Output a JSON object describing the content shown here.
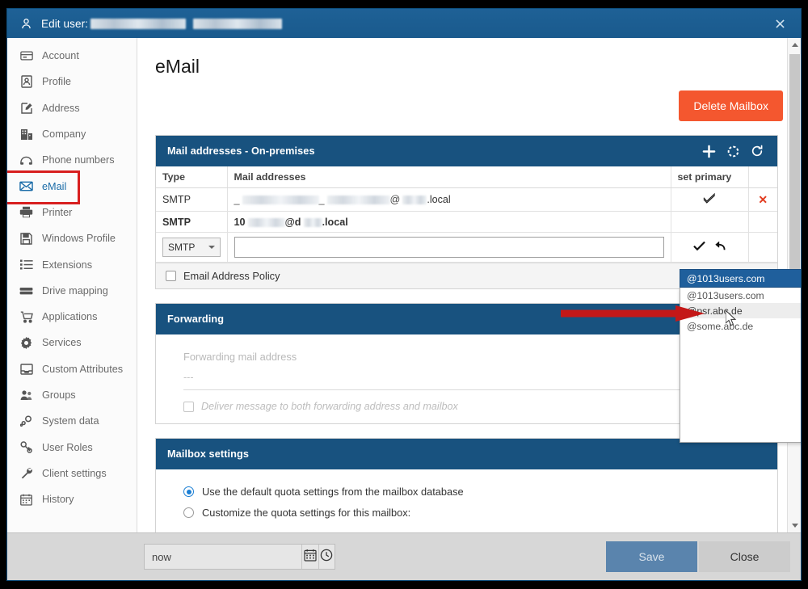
{
  "window": {
    "title_prefix": "Edit user:",
    "user_icon": "user-icon",
    "close_icon": "×"
  },
  "sidebar": {
    "items": [
      {
        "label": "Account",
        "icon": "account-card-icon",
        "active": false
      },
      {
        "label": "Profile",
        "icon": "profile-id-icon",
        "active": false
      },
      {
        "label": "Address",
        "icon": "address-edit-icon",
        "active": false
      },
      {
        "label": "Company",
        "icon": "company-building-icon",
        "active": false
      },
      {
        "label": "Phone numbers",
        "icon": "phone-icon",
        "active": false
      },
      {
        "label": "eMail",
        "icon": "envelope-icon",
        "active": true
      },
      {
        "label": "Printer",
        "icon": "printer-icon",
        "active": false
      },
      {
        "label": "Windows Profile",
        "icon": "floppy-disk-icon",
        "active": false
      },
      {
        "label": "Extensions",
        "icon": "list-icon",
        "active": false
      },
      {
        "label": "Drive mapping",
        "icon": "drive-icon",
        "active": false
      },
      {
        "label": "Applications",
        "icon": "cart-icon",
        "active": false
      },
      {
        "label": "Services",
        "icon": "gear-icon",
        "active": false
      },
      {
        "label": "Custom Attributes",
        "icon": "inbox-tray-icon",
        "active": false
      },
      {
        "label": "Groups",
        "icon": "groups-icon",
        "active": false
      },
      {
        "label": "System data",
        "icon": "system-data-icon",
        "active": false
      },
      {
        "label": "User Roles",
        "icon": "user-roles-key-icon",
        "active": false
      },
      {
        "label": "Client settings",
        "icon": "wrench-icon",
        "active": false
      },
      {
        "label": "History",
        "icon": "calendar-icon",
        "active": false
      }
    ]
  },
  "main": {
    "page_title": "eMail",
    "delete_mailbox_label": "Delete Mailbox",
    "delete_button_color": "#f4572f"
  },
  "mail_panel": {
    "header": "Mail addresses - On-premises",
    "header_color": "#18527f",
    "icons": [
      {
        "name": "add-icon",
        "glyph": "+"
      },
      {
        "name": "sync-icon",
        "glyph": "sync"
      },
      {
        "name": "refresh-icon",
        "glyph": "refresh"
      }
    ],
    "columns": [
      "Type",
      "Mail addresses",
      "set primary",
      ""
    ],
    "rows": [
      {
        "type": "SMTP",
        "address_suffix": ".local",
        "address_redacted": true,
        "bold": false,
        "set_primary_icon": "check-outline-icon",
        "delete_icon": "✕"
      },
      {
        "type": "SMTP",
        "address_prefix": "10",
        "address_middle": "@d",
        "address_suffix": ".local",
        "address_redacted": true,
        "bold": true,
        "set_primary_icon": "",
        "delete_icon": ""
      }
    ],
    "edit_row": {
      "type_value": "SMTP",
      "address_value": "",
      "address_placeholder": "",
      "domain_value": "@1013users.com",
      "confirm_icon": "check-solid-icon",
      "undo_icon": "undo-arrow-icon"
    },
    "policy_checkbox": {
      "label": "Email Address Policy",
      "checked": false
    }
  },
  "domain_dropdown": {
    "selected": "@1013users.com",
    "expanded": true,
    "options": [
      {
        "label": "@1013users.com",
        "hovered": false
      },
      {
        "label": "@psr.abc.de",
        "hovered": true
      },
      {
        "label": "@some.abc.de",
        "hovered": false
      }
    ]
  },
  "forwarding_panel": {
    "header": "Forwarding",
    "field_label": "Forwarding mail address",
    "field_value": "---",
    "deliver_checkbox": {
      "label": "Deliver message to both forwarding address and mailbox",
      "checked": false
    }
  },
  "mailbox_settings_panel": {
    "header": "Mailbox settings",
    "options": [
      {
        "label": "Use the default quota settings from the mailbox database",
        "selected": true
      },
      {
        "label": "Customize the quota settings for this mailbox:",
        "selected": false
      }
    ]
  },
  "bottom_bar": {
    "date_value": "now",
    "date_placeholder": "now",
    "calendar_icon": "calendar-icon",
    "clock_icon": "clock-icon",
    "save_label": "Save",
    "close_label": "Close"
  },
  "annotation": {
    "arrow_color": "#c41818",
    "points_to": "@psr.abc.de"
  }
}
